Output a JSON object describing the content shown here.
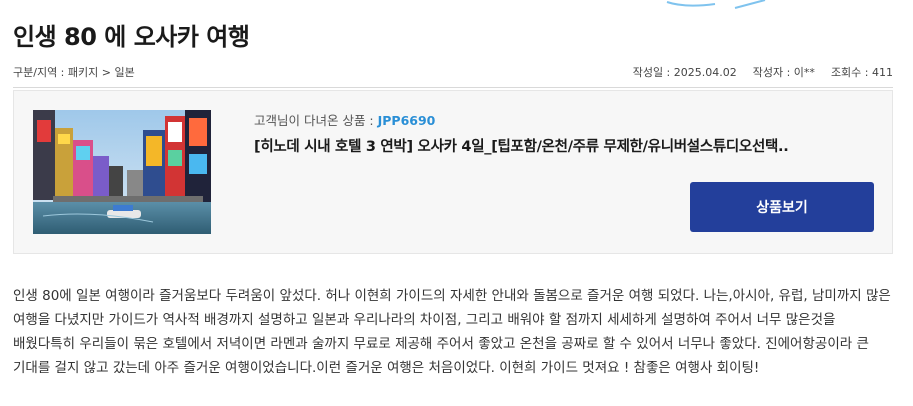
{
  "page": {
    "title": "인생 80 에 오사카 여행"
  },
  "meta": {
    "category": "구분/지역 : 패키지 > 일본",
    "date": "작성일 : 2025.04.02",
    "author": "작성자 : 이**",
    "views": "조회수 : 411"
  },
  "product": {
    "visited_label": "고객님이 다녀온 상품 : ",
    "code": "JPP6690",
    "name": "[히노데 시내 호텔 3 연박] 오사카 4일_[팁포함/온천/주류 무제한/유니버설스튜디오선택..",
    "view_button": "상품보기",
    "thumbnail_icon": "osaka-dotonbori-photo"
  },
  "review": {
    "body": " 인생 80에 일본 여행이라 즐거움보다 두려움이 앞섰다. 허나 이현희 가이드의 자세한 안내와 돌봄으로 즐거운 여행 되었다. 나는,아시아, 유럽, 남미까지 많은 여행을 다녔지만 가이드가 역사적 배경까지 설명하고 일본과 우리나라의 차이점, 그리고 배워야 할 점까지 세세하게 설명하여 주어서 너무 많은것을 배웠다특히 우리들이 묶은 호텔에서 저녁이면 라멘과 술까지 무료로 제공해 주어서 좋았고 온천을 공짜로 할 수 있어서 너무나 좋았다. 진에어항공이라 큰 기대를 걸지 않고 갔는데 아주 즐거운 여행이었습니다.이런 즐거운 여행은 처음이었다. 이현희 가이드 멋져요 ! 참좋은 여행사 회이팅!"
  },
  "colors": {
    "accent": "#233f9b",
    "code": "#2a8fd6"
  }
}
